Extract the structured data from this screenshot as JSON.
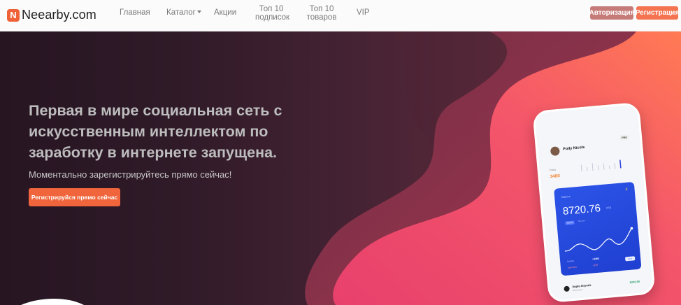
{
  "brand": {
    "icon_letter": "N",
    "name": "Neearby.com",
    "logo_color": "#ef6238"
  },
  "nav": {
    "items": [
      {
        "label": "Главная"
      },
      {
        "label": "Каталог"
      },
      {
        "label": "Акции"
      },
      {
        "label": "Топ 10\nподписок"
      },
      {
        "label": "Топ 10\nтоваров"
      },
      {
        "label": "VIP"
      }
    ],
    "auth_button": "Авторизация",
    "register_button": "Регистрация"
  },
  "hero": {
    "headline": "Первая в мире социальная сеть с искусственным интеллектом по заработку в интернете запущена.",
    "subline": "Моментально зарегистрируйтесь прямо сейчас!",
    "cta_button": "Регистрируйся прямо сейчас"
  },
  "phone": {
    "user_name": "Polly Nicols",
    "badge": "PRO",
    "today_label": "Today",
    "today_value": "3480",
    "card": {
      "balance_label": "Balance",
      "balance_value": "8720.76",
      "currency": "USD",
      "tag": "Income",
      "tag_secondary": "This year",
      "row1_label": "Income",
      "row1_value": "+3480",
      "row2_label": "Spending",
      "row2_value": "-978",
      "more_button": "More"
    },
    "item_name": "Apple Airpods",
    "item_sub": "Electronics",
    "item_price": "$240.90"
  },
  "colors": {
    "accent": "#f47350",
    "auth_button": "#c57b78",
    "cta": "#f0653b",
    "card_blue": "#2c54e8"
  }
}
